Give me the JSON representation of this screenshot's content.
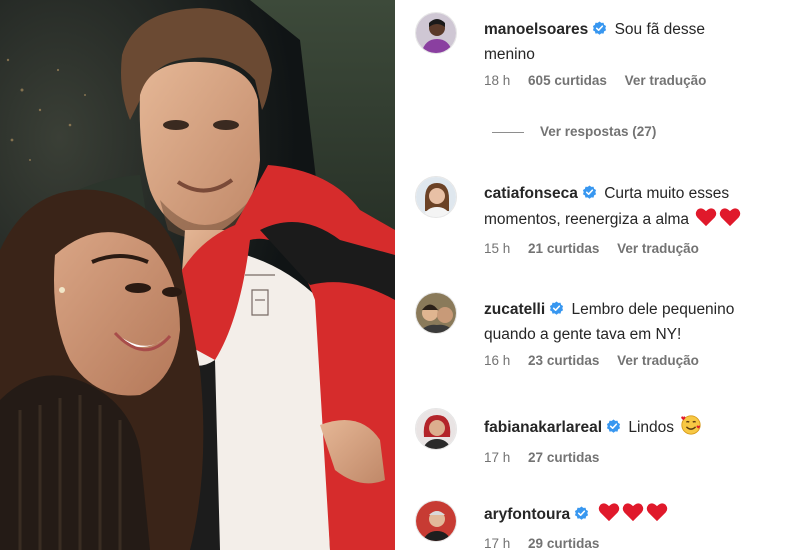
{
  "photo": {
    "alt_icons": [
      "photo-background",
      "person-woman",
      "person-man"
    ]
  },
  "comments": [
    {
      "username": "manoelsoares",
      "verified": true,
      "text_line1": "Sou fã desse",
      "text_line2": "menino",
      "time": "18 h",
      "likes": "605 curtidas",
      "translate": "Ver tradução"
    },
    {
      "view_replies": "Ver respostas (27)"
    },
    {
      "username": "catiafonseca",
      "verified": true,
      "text_line1": "Curta muito esses",
      "text_line2": "momentos, reenergiza a alma",
      "emoji": "heart-icon x2",
      "time": "15 h",
      "likes": "21 curtidas",
      "translate": "Ver tradução"
    },
    {
      "username": "zucatelli",
      "verified": true,
      "text_line1": "Lembro dele pequenino",
      "text_line2": "quando a gente tava em NY!",
      "time": "16 h",
      "likes": "23 curtidas",
      "translate": "Ver tradução"
    },
    {
      "username": "fabianakarlareal",
      "verified": true,
      "text_line1": "Lindos",
      "emoji": "smiling-face-with-hearts-icon",
      "time": "17 h",
      "likes": "27 curtidas"
    },
    {
      "username": "aryfontoura",
      "verified": true,
      "emoji": "heart-icon x3",
      "time": "17 h",
      "likes": "29 curtidas"
    }
  ],
  "colors": {
    "verified_blue": "#3897f0",
    "heart_red": "#e0192b",
    "meta_gray": "#737373",
    "text_dark": "#262626"
  }
}
